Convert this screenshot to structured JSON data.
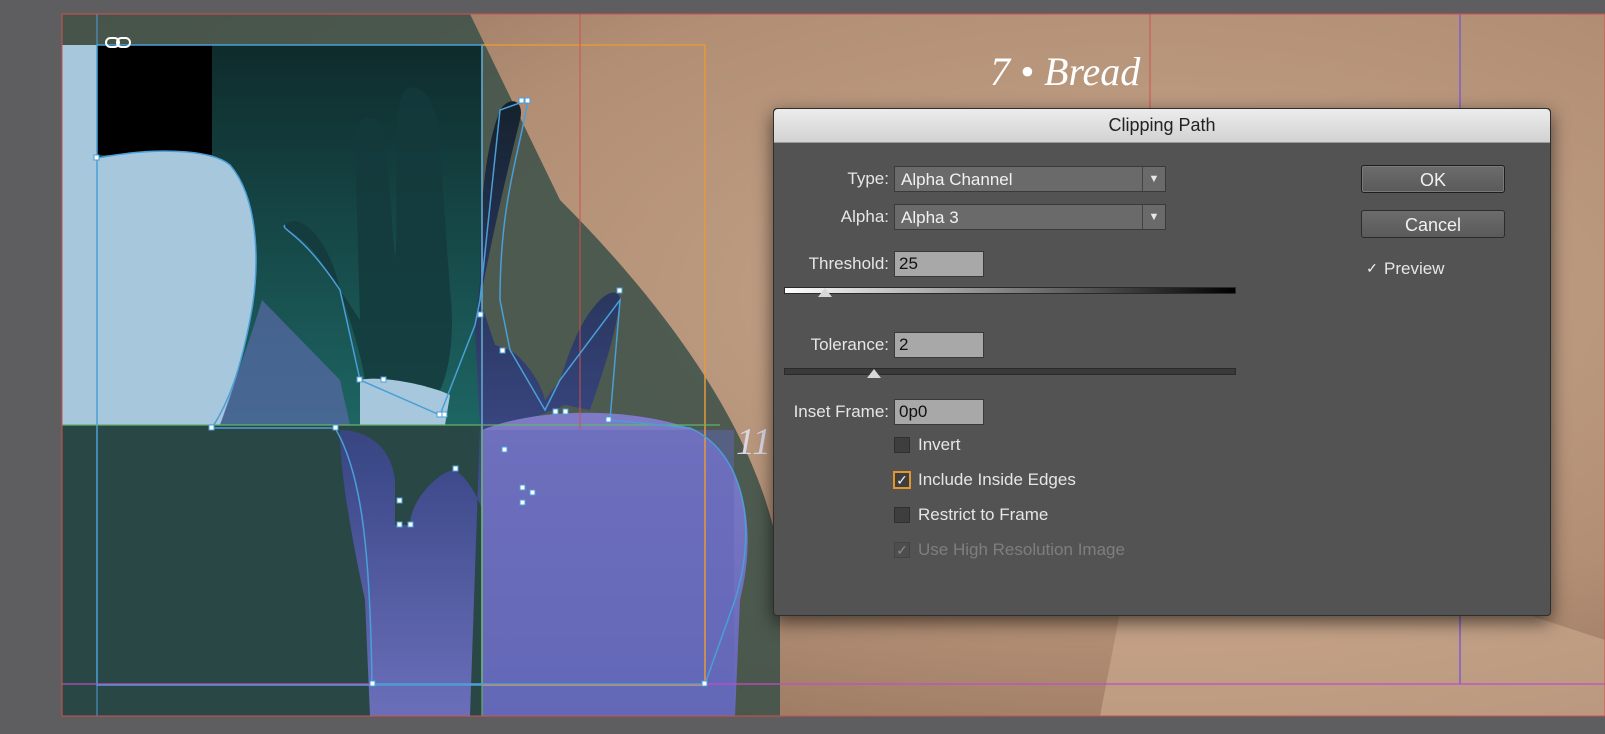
{
  "page": {
    "running_head": "7 • Bread",
    "partial_page_number": "11"
  },
  "dialog": {
    "title": "Clipping Path",
    "type": {
      "label": "Type:",
      "value": "Alpha Channel"
    },
    "alpha": {
      "label": "Alpha:",
      "value": "Alpha 3"
    },
    "threshold": {
      "label": "Threshold:",
      "value": "25",
      "slider_fraction": 0.09
    },
    "tolerance": {
      "label": "Tolerance:",
      "value": "2",
      "slider_fraction": 0.2
    },
    "inset_frame": {
      "label": "Inset Frame:",
      "value": "0p0"
    },
    "checkboxes": [
      {
        "label": "Invert",
        "checked": false,
        "enabled": true
      },
      {
        "label": "Include Inside Edges",
        "checked": true,
        "enabled": true
      },
      {
        "label": "Restrict to Frame",
        "checked": false,
        "enabled": true
      },
      {
        "label": "Use High Resolution Image",
        "checked": true,
        "enabled": false
      }
    ],
    "ok_label": "OK",
    "cancel_label": "Cancel",
    "preview": {
      "label": "Preview",
      "checked": true
    }
  },
  "icons": {
    "link": "link-icon",
    "dropdown_arrow": "chevron-down-icon",
    "checkmark": "checkmark-icon"
  },
  "colors": {
    "pasteboard": "#5e5e60",
    "dialog_bg": "#535353",
    "focus_ring": "#e6952e",
    "selection_path": "#4a9fd8",
    "frame_orange": "#e39a3c",
    "margin_magenta": "#c04dc8"
  }
}
